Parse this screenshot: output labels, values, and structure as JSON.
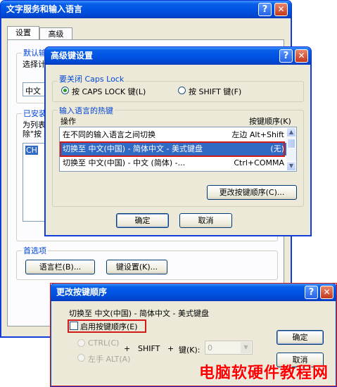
{
  "win1": {
    "title": "文字服务和输入语言",
    "tabs": [
      "设置",
      "高级"
    ],
    "default_group": "默认输",
    "default_desc": "选择计",
    "combo_value": "中文",
    "installed_group": "已安装",
    "installed_desc1": "为列表",
    "installed_desc2": "除\"按",
    "list_item": "CH",
    "prefs_group": "首选项",
    "langbar_button": "语言栏(B)...",
    "keysettings_button": "键设置(K)..."
  },
  "win2": {
    "title": "高级键设置",
    "caps_group": "要关闭 Caps Lock",
    "caps_option1": "按 CAPS LOCK 键(L)",
    "caps_option2": "按 SHIFT 键(F)",
    "hotkey_group": "输入语言的热键",
    "col_action": "操作",
    "col_sequence": "按键顺序(K)",
    "rows": [
      {
        "action": "在不同的输入语言之间切换",
        "keys": "左边 Alt+Shift"
      },
      {
        "action": "切换至 中文(中国) - 简体中文 - 美式键盘",
        "keys": "(无)"
      },
      {
        "action": "切换至 中文(中国) - 中文 (简体) -...",
        "keys": "Ctrl+COMMA"
      }
    ],
    "change_button": "更改按键顺序(C)...",
    "ok_button": "确定",
    "cancel_button": "取消"
  },
  "win3": {
    "title": "更改按键顺序",
    "target": "切换至 中文(中国) - 简体中文 - 美式键盘",
    "enable_checkbox": "启用按键顺序(E)",
    "ctrl_option": "CTRL(C)",
    "alt_option": "左手 ALT(A)",
    "plus1": "+",
    "shift_label": "SHIFT",
    "plus2": "+",
    "key_label": "键(K):",
    "key_value": "0",
    "ok_button": "确定",
    "cancel_button": "取消"
  },
  "watermark": "电脑软硬件教程网",
  "colors": {
    "titlebar": "#0054e3",
    "group_label": "#0046d5",
    "highlight_box": "#d21a1a",
    "watermark": "#ff0000"
  }
}
